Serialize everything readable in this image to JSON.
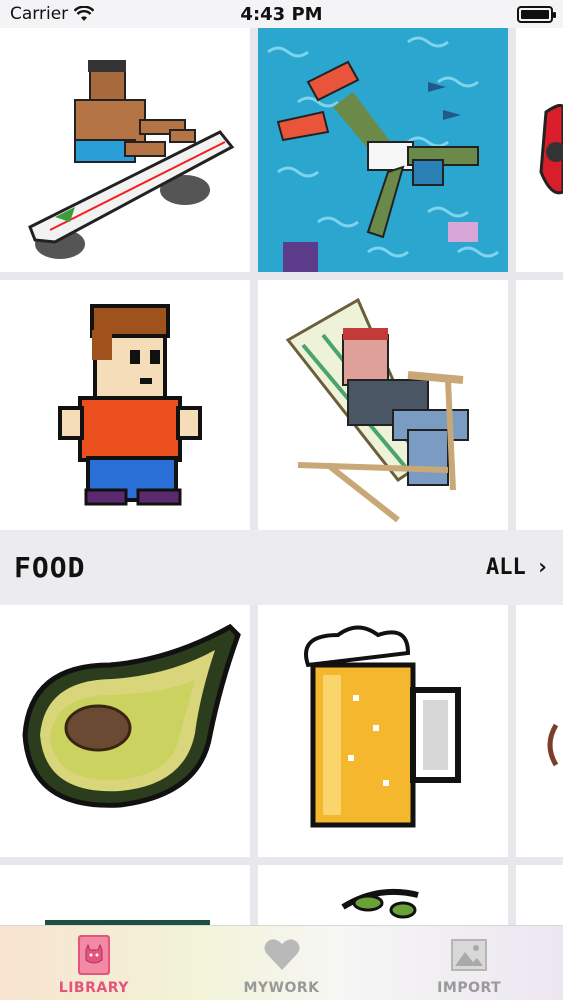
{
  "status_bar": {
    "carrier": "Carrier",
    "time": "4:43 PM"
  },
  "sections": {
    "top": {
      "items": [
        "surfer-on-surfboard",
        "diver-snorkeling",
        "red-car-partial",
        "boy-red-shirt",
        "woman-beach-chair",
        "blank-partial"
      ]
    },
    "food": {
      "title": "FOOD",
      "all_label": "ALL",
      "items": [
        "avocado",
        "beer-mug",
        "food-partial",
        "food-item",
        "olive-branch",
        "food-partial-2"
      ]
    }
  },
  "tab_bar": {
    "tabs": [
      {
        "label": "LIBRARY",
        "icon": "book-cat-icon",
        "active": true
      },
      {
        "label": "MYWORK",
        "icon": "heart-icon",
        "active": false
      },
      {
        "label": "IMPORT",
        "icon": "image-icon",
        "active": false
      }
    ]
  },
  "colors": {
    "accent": "#e4547c",
    "background": "#e8e8ec",
    "tile": "#ffffff"
  }
}
